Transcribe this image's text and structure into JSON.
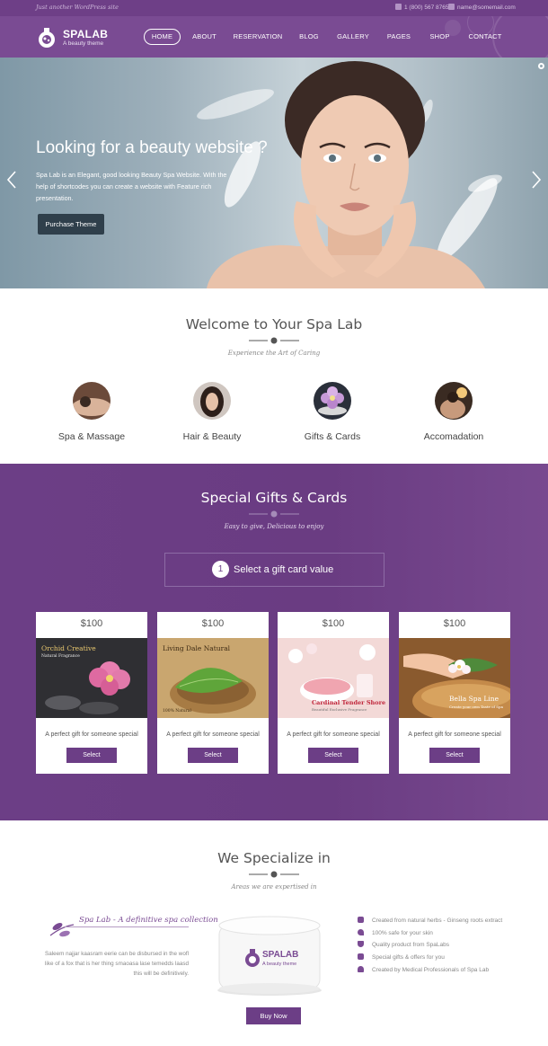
{
  "topbar": {
    "tagline": "Just another WordPress site",
    "phone": "1 (800) 567 8765",
    "email": "name@somemail.com"
  },
  "brand": {
    "name": "SPALAB",
    "tagline": "A beauty theme"
  },
  "nav": {
    "items": [
      "HOME",
      "ABOUT",
      "RESERVATION",
      "BLOG",
      "GALLERY",
      "PAGES",
      "SHOP",
      "CONTACT"
    ],
    "active": "HOME"
  },
  "hero": {
    "title": "Looking for a beauty website ?",
    "text": "Spa Lab is an Elegant, good looking Beauty Spa Website. With the help of shortcodes you can create a website with Feature rich presentation.",
    "button": "Purchase Theme"
  },
  "welcome": {
    "title": "Welcome to Your Spa Lab",
    "subtitle": "Experience the Art of Caring",
    "services": [
      "Spa & Massage",
      "Hair & Beauty",
      "Gifts & Cards",
      "Accomadation"
    ]
  },
  "gifts": {
    "title": "Special Gifts & Cards",
    "subtitle": "Easy to give, Delicious to enjoy",
    "step_number": "1",
    "step_label": "Select a gift card value",
    "cards": [
      {
        "price": "$100",
        "caption": "Orchid Creative",
        "caption_sub": "Natural Fragrance",
        "desc": "A perfect gift for someone special",
        "button": "Select"
      },
      {
        "price": "$100",
        "caption": "Living Dale Natural",
        "caption_sub": "100% Natural",
        "desc": "A perfect gift for someone special",
        "button": "Select"
      },
      {
        "price": "$100",
        "caption": "Cardinal Tender Shore",
        "caption_sub": "Beautiful Exclusive Fragrance",
        "desc": "A perfect gift for someone special",
        "button": "Select"
      },
      {
        "price": "$100",
        "caption": "Bella Spa Line",
        "caption_sub": "Create your own Taste of Spa",
        "desc": "A perfect gift for someone special",
        "button": "Select"
      }
    ]
  },
  "specialize": {
    "title": "We Specialize in",
    "subtitle": "Areas we are expertised in",
    "left_title": "Spa Lab - A definitive spa collection",
    "left_text": "Saleem najjar kaasram eerie can be disbursed in the wofl like of a fox that is her thing smaoasa lase temedds laasd this will be definitively.",
    "jar_brand": "SPALAB",
    "jar_sub": "A beauty theme",
    "features": [
      "Created from natural herbs - Ginseng roots extract",
      "100% safe for your skin",
      "Quality product from SpaLabs",
      "Special gifts & offers for you",
      "Created by Medical Professionals of Spa Lab"
    ],
    "button": "Buy Now"
  }
}
